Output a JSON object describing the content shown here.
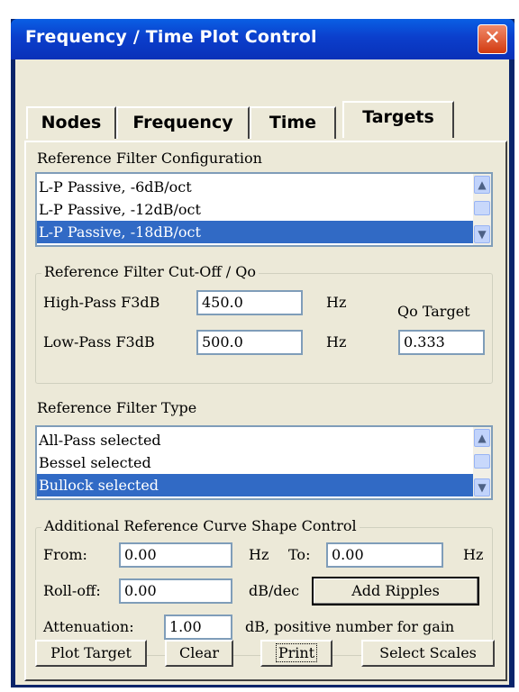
{
  "window": {
    "title": "Frequency / Time Plot Control",
    "close_glyph": "✕"
  },
  "tabs": [
    "Nodes",
    "Frequency",
    "Time",
    "Targets"
  ],
  "active_tab": "Targets",
  "ref_filter_config": {
    "label": "Reference Filter Configuration",
    "items": [
      "L-P Passive, -6dB/oct",
      "L-P Passive, -12dB/oct",
      "L-P Passive, -18dB/oct"
    ],
    "selected": "L-P Passive, -18dB/oct"
  },
  "cutoff_group": {
    "legend": "Reference Filter Cut-Off / Qo",
    "highpass_label": "High-Pass F3dB",
    "highpass_value": "450.0",
    "lowpass_label": "Low-Pass F3dB",
    "lowpass_value": "500.0",
    "unit_hz": "Hz",
    "qo_label": "Qo Target",
    "qo_value": "0.333"
  },
  "ref_filter_type": {
    "label": "Reference Filter Type",
    "items": [
      "All-Pass selected",
      "Bessel selected",
      "Bullock selected"
    ],
    "selected": "Bullock selected"
  },
  "shape_group": {
    "legend": "Additional Reference Curve Shape Control",
    "from_label": "From:",
    "from_value": "0.00",
    "hz1": "Hz",
    "to_label": "To:",
    "to_value": "0.00",
    "hz2": "Hz",
    "rolloff_label": "Roll-off:",
    "rolloff_value": "0.00",
    "rolloff_unit": "dB/dec",
    "add_ripples": "Add Ripples",
    "atten_label": "Attenuation:",
    "atten_value": "1.00",
    "atten_unit": "dB, positive number for gain"
  },
  "buttons": {
    "plot_target": "Plot Target",
    "clear": "Clear",
    "print": "Print",
    "select_scales": "Select Scales"
  },
  "icons": {
    "scroll_up": "▲",
    "scroll_down": "▼"
  },
  "colors": {
    "title_bar": "#0b3fcc",
    "selection": "#316ac5",
    "close_button": "#d23a10"
  }
}
